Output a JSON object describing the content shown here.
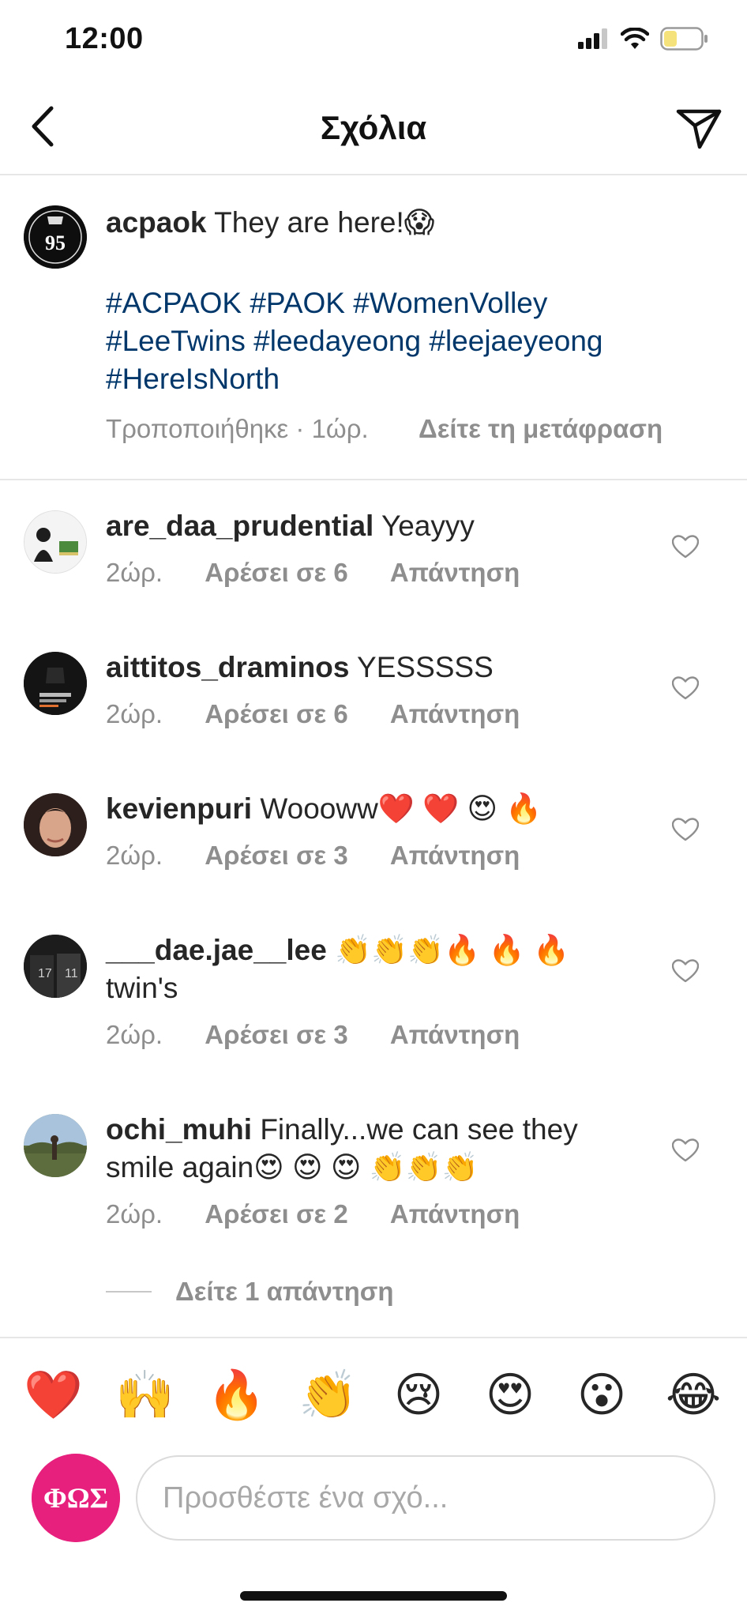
{
  "status": {
    "time": "12:00",
    "battery_color": "#f5e27a"
  },
  "header": {
    "title": "Σχόλια",
    "back_icon": "chevron-left-icon",
    "share_icon": "paper-plane-icon"
  },
  "caption": {
    "username": "acpaok",
    "text": "They are here!😱",
    "hashtags_line1": "#ACPAOK #PAOK #WomenVolley",
    "hashtags_line2": "#LeeTwins #leedayeong #leejaeyeong",
    "hashtags_line3": "#HereIsNorth",
    "meta": "Τροποποιήθηκε · 1ώρ.",
    "see_translation": "Δείτε τη μετάφραση",
    "avatar_text": "95"
  },
  "comments": [
    {
      "username": "are_daa_prudential",
      "text": "Yeayyy",
      "time": "2ώρ.",
      "likes": "Αρέσει σε 6",
      "reply": "Απάντηση"
    },
    {
      "username": "aittitos_draminos",
      "text": "YESSSSS",
      "time": "2ώρ.",
      "likes": "Αρέσει σε 6",
      "reply": "Απάντηση"
    },
    {
      "username": "kevienpuri",
      "text": "Woooww❤️ ❤️ 😍 🔥",
      "time": "2ώρ.",
      "likes": "Αρέσει σε 3",
      "reply": "Απάντηση"
    },
    {
      "username": "___dae.jae__lee",
      "text": "👏👏👏🔥 🔥 🔥 twin's",
      "time": "2ώρ.",
      "likes": "Αρέσει σε 3",
      "reply": "Απάντηση"
    },
    {
      "username": "ochi_muhi",
      "text": "Finally...we can see they smile again😍 😍 😍 👏👏👏",
      "time": "2ώρ.",
      "likes": "Αρέσει σε 2",
      "reply": "Απάντηση"
    }
  ],
  "view_replies": "Δείτε 1 απάντηση",
  "emoji_bar": [
    "❤️",
    "🙌",
    "🔥",
    "👏",
    "😢",
    "😍",
    "😮",
    "😂"
  ],
  "composer": {
    "placeholder": "Προσθέστε ένα σχό...",
    "value": "",
    "avatar_text": "ΦΩΣ"
  }
}
